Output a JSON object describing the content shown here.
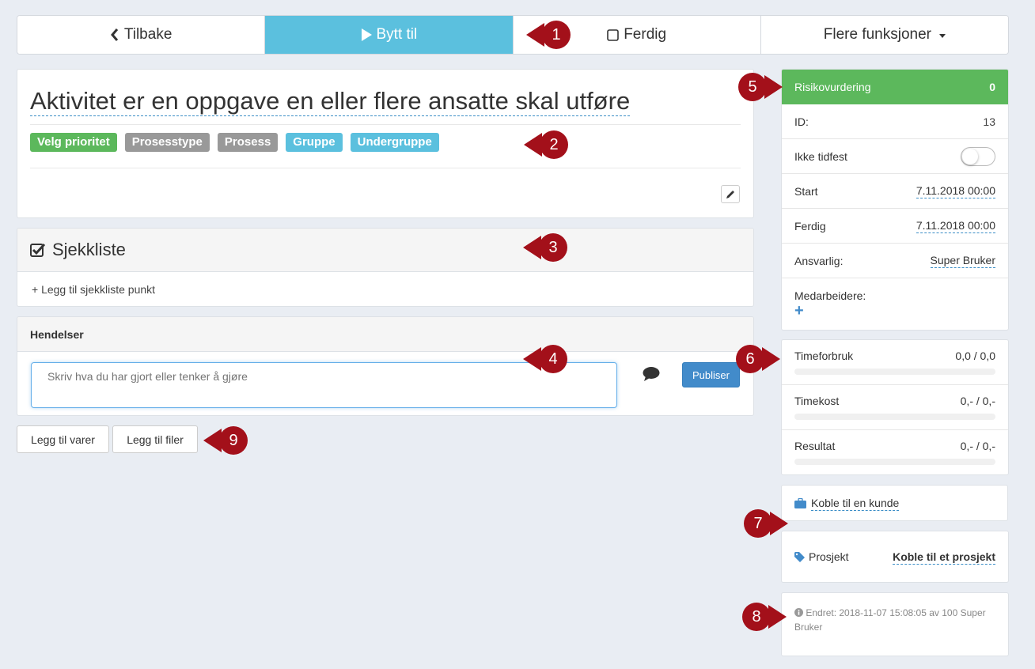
{
  "toolbar": {
    "back_label": "Tilbake",
    "switch_label": "Bytt til",
    "done_label": "Ferdig",
    "more_label": "Flere funksjoner"
  },
  "task": {
    "title": "Aktivitet er en oppgave en eller flere ansatte skal utføre",
    "labels": {
      "priority": "Velg prioritet",
      "process_type": "Prosesstype",
      "process": "Prosess",
      "group": "Gruppe",
      "subgroup": "Undergruppe"
    }
  },
  "checklist": {
    "title": "Sjekkliste",
    "add_label": "+ Legg til sjekkliste punkt"
  },
  "events": {
    "title": "Hendelser",
    "placeholder": "Skriv hva du har gjort eller tenker å gjøre",
    "publish_label": "Publiser"
  },
  "actions": {
    "add_items_label": "Legg til varer",
    "add_files_label": "Legg til filer"
  },
  "info": {
    "risk_label": "Risikovurdering",
    "risk_value": "0",
    "id_label": "ID:",
    "id_value": "13",
    "untimed_label": "Ikke tidfest",
    "start_label": "Start",
    "start_value": "7.11.2018 00:00",
    "end_label": "Ferdig",
    "end_value": "7.11.2018 00:00",
    "responsible_label": "Ansvarlig:",
    "responsible_value": "Super Bruker",
    "colleagues_label": "Medarbeidere:",
    "add_colleague": "+"
  },
  "time": {
    "hours_label": "Timeforbruk",
    "hours_value": "0,0 / 0,0",
    "cost_label": "Timekost",
    "cost_value": "0,- / 0,-",
    "result_label": "Resultat",
    "result_value": "0,- / 0,-"
  },
  "customer": {
    "link_label": "Koble til en kunde"
  },
  "project": {
    "label": "Prosjekt",
    "link_label": "Koble til et prosjekt"
  },
  "changed": {
    "text": "Endret: 2018-11-07 15:08:05 av 100 Super Bruker"
  },
  "callouts": [
    "1",
    "2",
    "3",
    "4",
    "5",
    "6",
    "7",
    "8",
    "9"
  ],
  "colors": {
    "accent": "#5bc0de",
    "success": "#5cb85c",
    "primary": "#428bca",
    "callout": "#a3101a"
  }
}
